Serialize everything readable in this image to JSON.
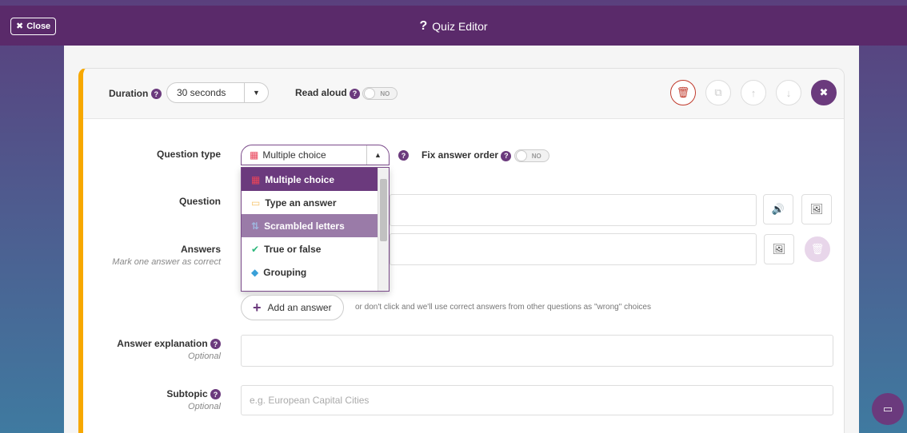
{
  "topbar": {
    "close_label": "Close",
    "title": "Quiz Editor"
  },
  "header": {
    "duration_label": "Duration",
    "duration_value": "30 seconds",
    "read_aloud_label": "Read aloud",
    "read_aloud_toggle": "NO"
  },
  "question_type": {
    "label": "Question type",
    "selected": "Multiple choice",
    "fix_order_label": "Fix answer order",
    "fix_order_toggle": "NO",
    "options": [
      {
        "label": "Multiple choice",
        "icon": "grid-icon",
        "color": "#e8445a"
      },
      {
        "label": "Type an answer",
        "icon": "keyboard-icon",
        "color": "#f7c46c"
      },
      {
        "label": "Scrambled letters",
        "icon": "scramble-icon",
        "color": "#9fb8e0"
      },
      {
        "label": "True or false",
        "icon": "check-circle-icon",
        "color": "#2eb87c"
      },
      {
        "label": "Grouping",
        "icon": "shapes-icon",
        "color": "#3aa0d8"
      }
    ]
  },
  "question": {
    "label": "Question"
  },
  "answers": {
    "label": "Answers",
    "sub": "Mark one answer as correct",
    "add_label": "Add an answer",
    "add_hint": "or don't click and we'll use correct answers from other questions as \"wrong\" choices"
  },
  "explanation": {
    "label": "Answer explanation",
    "sub": "Optional"
  },
  "subtopic": {
    "label": "Subtopic",
    "sub": "Optional",
    "placeholder": "e.g. European Capital Cities"
  },
  "colors": {
    "brand": "#5a2a6a",
    "accent": "#f7a800",
    "danger": "#c0392b"
  }
}
